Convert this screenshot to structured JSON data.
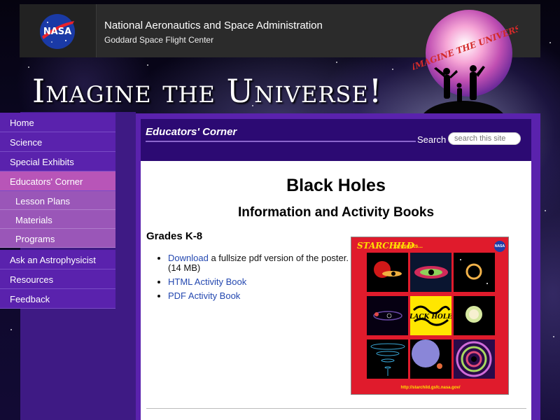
{
  "header": {
    "agency_name": "National Aeronautics and Space Administration",
    "center_name": "Goddard Space Flight Center",
    "logo_text": "NASA"
  },
  "banner": {
    "site_title": "Imagine the Universe!",
    "logo_text": "IMAGINE THE UNIVERSE!"
  },
  "sidebar": {
    "items": [
      {
        "label": "Home"
      },
      {
        "label": "Science"
      },
      {
        "label": "Special Exhibits"
      },
      {
        "label": "Educators' Corner"
      },
      {
        "label": "Lesson Plans"
      },
      {
        "label": "Materials"
      },
      {
        "label": "Programs"
      },
      {
        "label": "Ask an Astrophysicist"
      },
      {
        "label": "Resources"
      },
      {
        "label": "Feedback"
      }
    ]
  },
  "section": {
    "title": "Educators' Corner",
    "search_label": "Search",
    "search_placeholder": "search this site"
  },
  "main": {
    "heading": "Black Holes",
    "subheading": "Information and Activity Books",
    "grades": "Grades K-8",
    "download_link": "Download",
    "download_rest": " a fullsize pdf version of the poster. (14 MB)",
    "html_book": "HTML Activity Book",
    "pdf_book": "PDF Activity Book"
  },
  "poster": {
    "brand": "STARCHILD",
    "presents": "presents...",
    "nasa_badge": "NASA",
    "title": "BLACK HOLES",
    "url": "http://starchild.gsfc.nasa.gov/"
  },
  "colors": {
    "nav_bg": "#5a22ad",
    "nav_active": "#b855b8",
    "nav_sub": "#9a56b8",
    "section_band": "#2c0a73",
    "link": "#2448b0",
    "poster_bg": "#e01b2c",
    "poster_center": "#ffe600"
  }
}
